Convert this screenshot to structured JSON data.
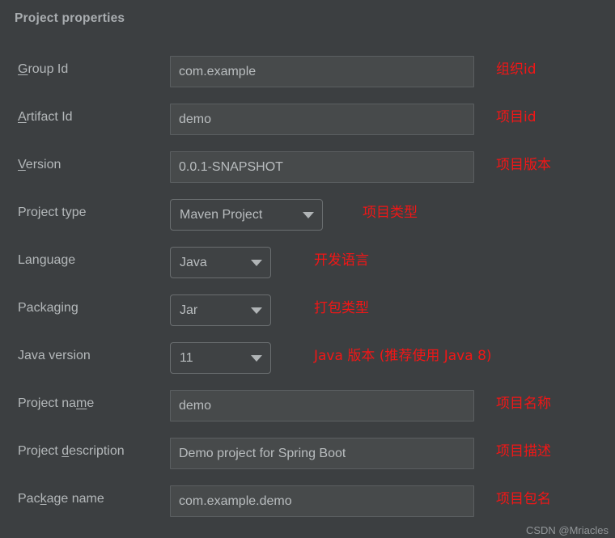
{
  "panel": {
    "title": "Project properties"
  },
  "colors": {
    "background": "#3c3f41",
    "field_background": "#474a4b",
    "label_text": "#b4b8ba",
    "value_text": "#b9bdbf",
    "annotation_red": "#f21616"
  },
  "rows": [
    {
      "id": "group-id",
      "label_pre": "",
      "label_mnemonic": "G",
      "label_post": "roup Id",
      "control": "text",
      "value": "com.example",
      "note": "组织id"
    },
    {
      "id": "artifact-id",
      "label_pre": "",
      "label_mnemonic": "A",
      "label_post": "rtifact Id",
      "control": "text",
      "value": "demo",
      "note": "项目id"
    },
    {
      "id": "version",
      "label_pre": "",
      "label_mnemonic": "V",
      "label_post": "ersion",
      "control": "text",
      "value": "0.0.1-SNAPSHOT",
      "note": "项目版本"
    },
    {
      "id": "project-type",
      "label_pre": "Project type",
      "label_mnemonic": "",
      "label_post": "",
      "control": "combo-wide",
      "value": "Maven Project",
      "note": "项目类型"
    },
    {
      "id": "language",
      "label_pre": "Language",
      "label_mnemonic": "",
      "label_post": "",
      "control": "combo-narrow",
      "value": "Java",
      "note": "开发语言"
    },
    {
      "id": "packaging",
      "label_pre": "Packaging",
      "label_mnemonic": "",
      "label_post": "",
      "control": "combo-narrow",
      "value": "Jar",
      "note": "打包类型"
    },
    {
      "id": "java-version",
      "label_pre": "Java version",
      "label_mnemonic": "",
      "label_post": "",
      "control": "combo-narrow",
      "value": "11",
      "note": "Java 版本 (推荐使用 Java 8)"
    },
    {
      "id": "project-name",
      "label_pre": "Project na",
      "label_mnemonic": "m",
      "label_post": "e",
      "control": "text",
      "value": "demo",
      "note": "项目名称"
    },
    {
      "id": "project-description",
      "label_pre": "Project ",
      "label_mnemonic": "d",
      "label_post": "escription",
      "control": "text",
      "value": "Demo project for Spring Boot",
      "note": "项目描述"
    },
    {
      "id": "package-name",
      "label_pre": "Pac",
      "label_mnemonic": "k",
      "label_post": "age name",
      "control": "text",
      "value": "com.example.demo",
      "note": "项目包名"
    }
  ],
  "watermark": "CSDN @Mriacles",
  "icons": {
    "dropdown": "chevron-down-icon"
  }
}
